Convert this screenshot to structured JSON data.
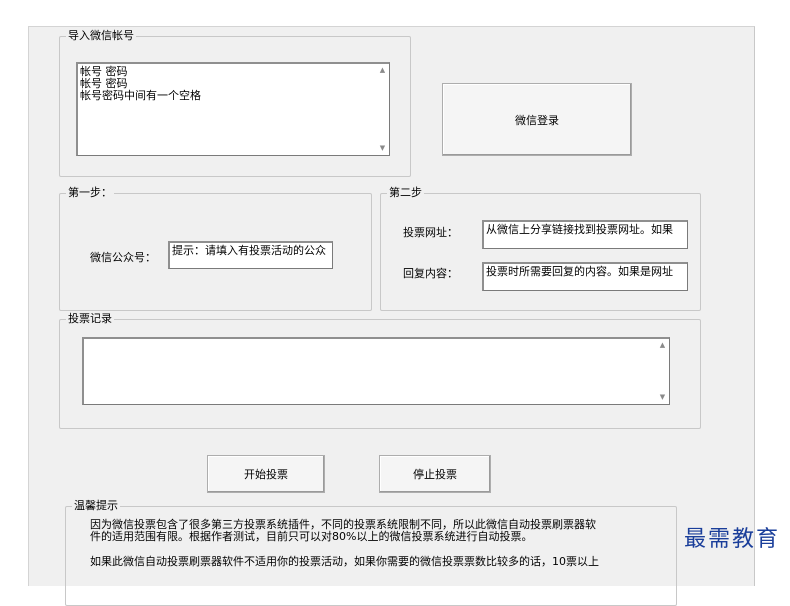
{
  "import_group": {
    "title": "导入微信帐号",
    "accounts_text": "帐号 密码\n帐号 密码\n帐号密码中间有一个空格",
    "login_button": "微信登录"
  },
  "step1": {
    "title": "第一步：",
    "account_label": "微信公众号：",
    "account_value": "提示：请填入有投票活动的公众"
  },
  "step2": {
    "title": "第二步",
    "url_label": "投票网址：",
    "url_value": "从微信上分享链接找到投票网址。如果",
    "reply_label": "回复内容：",
    "reply_value": "投票时所需要回复的内容。如果是网址"
  },
  "log_group": {
    "title": "投票记录",
    "content": ""
  },
  "controls": {
    "start_button": "开始投票",
    "stop_button": "停止投票"
  },
  "tips": {
    "title": "温馨提示",
    "para1_line1": "因为微信投票包含了很多第三方投票系统插件，不同的投票系统限制不同，所以此微信自动投票刷票器软",
    "para1_line2": "件的适用范围有限。根据作者测试，目前只可以对80%以上的微信投票系统进行自动投票。",
    "para2_line1": "如果此微信自动投票刷票器软件不适用你的投票活动，如果你需要的微信投票票数比较多的话，10票以上"
  },
  "watermark": "最需教育"
}
